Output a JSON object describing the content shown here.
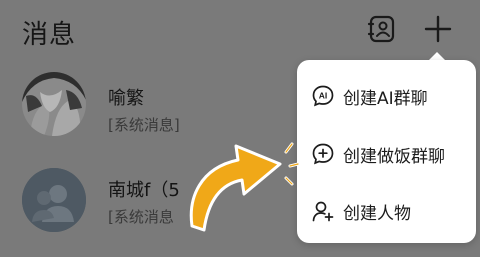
{
  "header": {
    "title": "消息"
  },
  "chats": [
    {
      "name": "喻繁",
      "preview": "[系统消息]"
    },
    {
      "name": "南城f（5",
      "preview": "[系统消息"
    }
  ],
  "menu": {
    "items": [
      {
        "label": "创建AI群聊",
        "icon": "ai-chat-icon",
        "icon_text": "AI"
      },
      {
        "label": "创建做饭群聊",
        "icon": "chat-plus-icon"
      },
      {
        "label": "创建人物",
        "icon": "add-person-icon"
      }
    ]
  },
  "colors": {
    "overlay": "#7a7a7a",
    "menu_bg": "#ffffff",
    "arrow_fill": "#f0a818",
    "arrow_outline": "#ffffff"
  }
}
